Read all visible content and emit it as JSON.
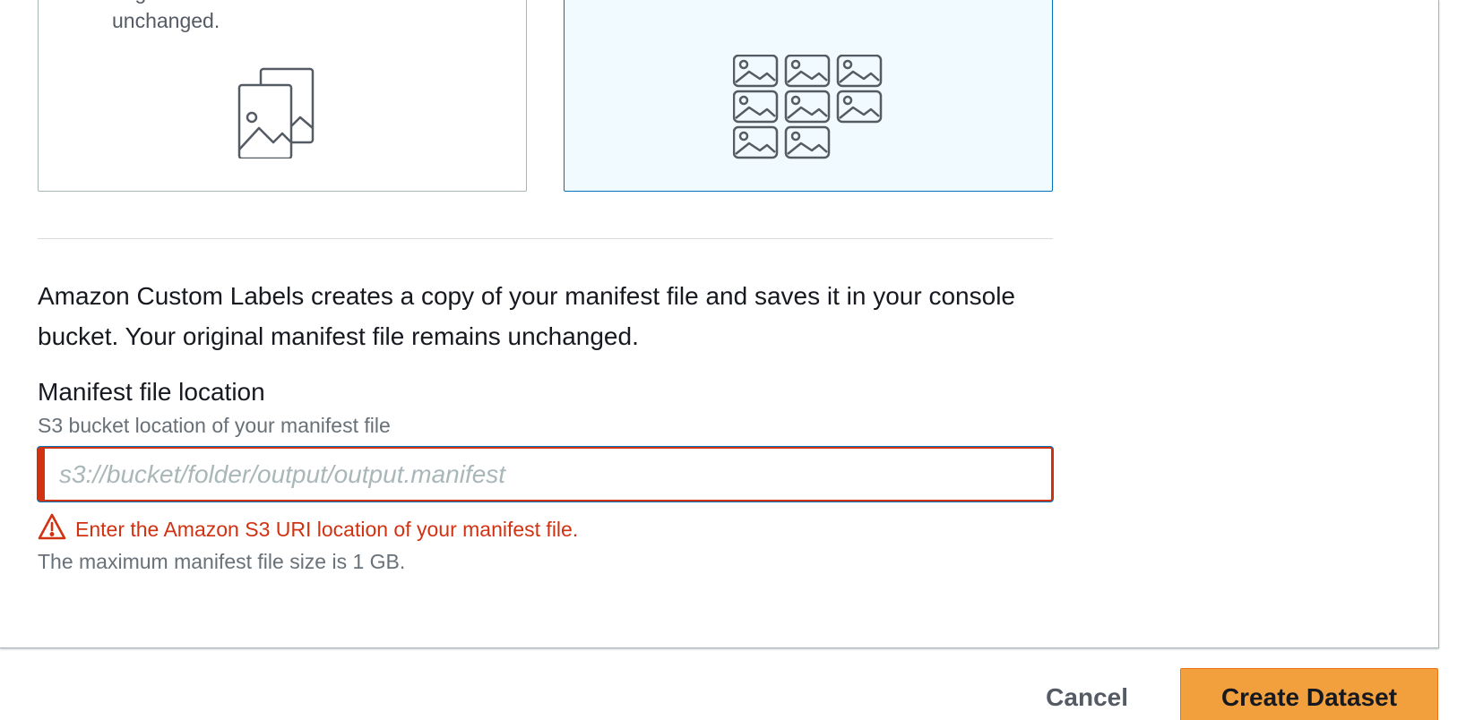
{
  "cards": {
    "left": {
      "description": "original dataset will remain unchanged.",
      "icon": "overlapping-images-icon"
    },
    "right": {
      "icon": "image-grid-icon",
      "selected": true
    }
  },
  "info_text": "Amazon Custom Labels creates a copy of your manifest file and saves it in your console bucket. Your original manifest file remains unchanged.",
  "manifest": {
    "label": "Manifest file location",
    "description": "S3 bucket location of your manifest file",
    "placeholder": "s3://bucket/folder/output/output.manifest",
    "value": "",
    "error": "Enter the Amazon S3 URI location of your manifest file.",
    "constraint": "The maximum manifest file size is 1 GB."
  },
  "actions": {
    "cancel_label": "Cancel",
    "create_label": "Create Dataset"
  },
  "colors": {
    "error": "#d13212",
    "selected_border": "#0073bb",
    "selected_bg": "#f1faff",
    "primary_button": "#f2a03d"
  }
}
